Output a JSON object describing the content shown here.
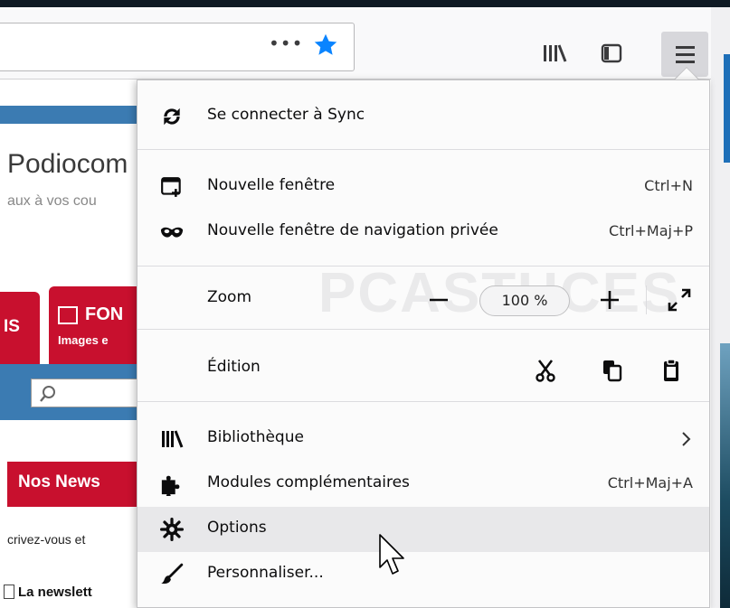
{
  "page_behind": {
    "title": "Podiocom",
    "subtitle": "aux à vos cou",
    "tab_1": "IS",
    "tab_2": "FON",
    "tab_2_sub": "Images e",
    "news_bar": "Nos News",
    "news_sub": "crivez-vous et",
    "newsletter": "La newslett"
  },
  "toolbar": {
    "more_glyph": "•••",
    "icons": [
      "star-icon",
      "library-icon",
      "sidebar-icon",
      "hamburger-menu-icon"
    ],
    "accent_color": "#0a84ff"
  },
  "menu": {
    "sync": {
      "label": "Se connecter à Sync",
      "icon": "sync-icon"
    },
    "new_window": {
      "label": "Nouvelle fenêtre",
      "shortcut": "Ctrl+N",
      "icon": "new-window-icon"
    },
    "private_window": {
      "label": "Nouvelle fenêtre de navigation privée",
      "shortcut": "Ctrl+Maj+P",
      "icon": "private-mask-icon"
    },
    "zoom": {
      "label": "Zoom",
      "value": "100 %"
    },
    "edit": {
      "label": "Édition"
    },
    "library": {
      "label": "Bibliothèque",
      "icon": "library-icon"
    },
    "addons": {
      "label": "Modules complémentaires",
      "shortcut": "Ctrl+Maj+A",
      "icon": "puzzle-icon"
    },
    "options": {
      "label": "Options",
      "icon": "gear-icon",
      "hovered": true
    },
    "customize": {
      "label": "Personnaliser...",
      "icon": "brush-icon"
    }
  },
  "watermark": "PCASTUCES"
}
